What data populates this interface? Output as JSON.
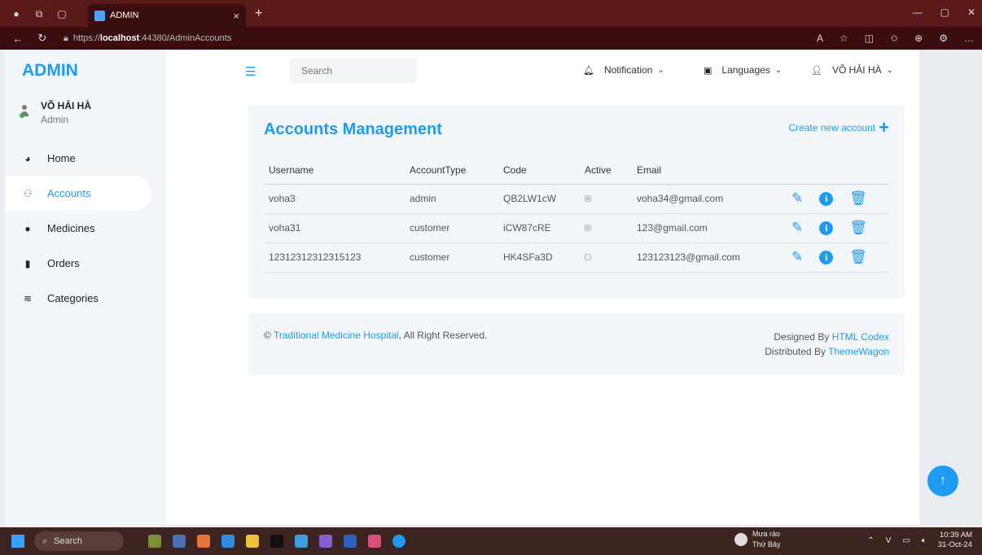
{
  "browser": {
    "tab_title": "ADMIN",
    "tab_close": "×",
    "new_tab": "+",
    "url_prefix": "https://",
    "url_host": "localhost",
    "url_rest": ":44380/AdminAccounts"
  },
  "sidebar": {
    "brand": "ADMIN",
    "user_name": "VÕ HẢI HÀ",
    "user_role": "Admin",
    "items": [
      {
        "label": "Home",
        "icon": "dashboard-icon"
      },
      {
        "label": "Accounts",
        "icon": "users-icon"
      },
      {
        "label": "Medicines",
        "icon": "pills-icon"
      },
      {
        "label": "Orders",
        "icon": "file-icon"
      },
      {
        "label": "Categories",
        "icon": "layers-icon"
      }
    ],
    "active_index": 1
  },
  "topnav": {
    "search_placeholder": "Search",
    "notification": "Notification",
    "languages": "Languages",
    "user": "VÕ HẢI HÀ"
  },
  "accounts": {
    "title": "Accounts Management",
    "create_label": "Create new account",
    "columns": [
      "Username",
      "AccountType",
      "Code",
      "Active",
      "Email"
    ],
    "rows": [
      {
        "username": "voha3",
        "type": "admin",
        "code": "QB2LW1cW",
        "active": true,
        "email": "voha34@gmail.com"
      },
      {
        "username": "voha31",
        "type": "customer",
        "code": "iCW87cRE",
        "active": true,
        "email": "123@gmail.com"
      },
      {
        "username": "12312312312315123",
        "type": "customer",
        "code": "HK4SFa3D",
        "active": false,
        "email": "123123123@gmail.com"
      }
    ]
  },
  "footer": {
    "copyright_symbol": "©",
    "hospital_link": "Traditional Medicine Hospital",
    "rights": ", All Right Reserved.",
    "designed_by": "Designed By ",
    "designer_link": "HTML Codex",
    "distributed_by": "Distributed By ",
    "distributor_link": "ThemeWagon"
  },
  "taskbar": {
    "search": "Search",
    "weather_title": "Mưa rào",
    "weather_sub": "Thứ Bảy",
    "time": "10:39 AM",
    "date": "31-Oct-24"
  },
  "colors": {
    "accent": "#1e9bf0",
    "panel": "#f3f6f9",
    "titlebar": "#5b1a1a"
  }
}
